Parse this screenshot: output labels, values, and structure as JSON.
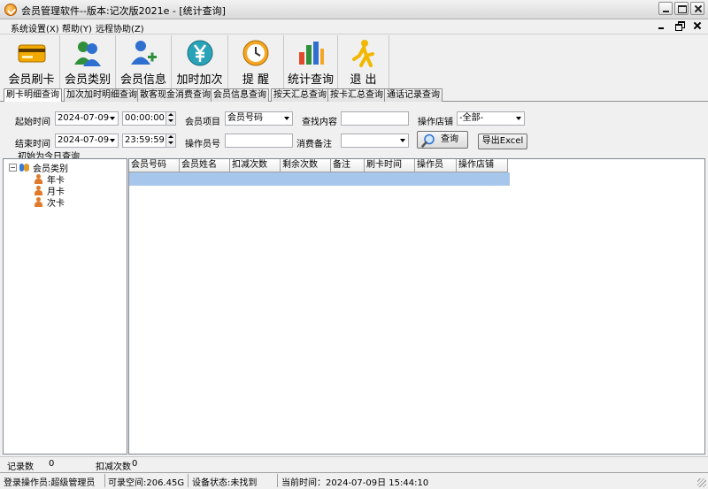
{
  "window": {
    "title": "会员管理软件--版本:记次版2021e - [统计查询]"
  },
  "menu": {
    "items": [
      "系统设置(X)",
      "帮助(Y)",
      "远程协助(Z)"
    ]
  },
  "toolbar": {
    "buttons": [
      {
        "label": "会员刷卡",
        "icon": "card-icon"
      },
      {
        "label": "会员类别",
        "icon": "users-icon"
      },
      {
        "label": "会员信息",
        "icon": "add-user-icon"
      },
      {
        "label": "加时加次",
        "icon": "yen-icon"
      },
      {
        "label": "提 醒",
        "icon": "clock-icon"
      },
      {
        "label": "统计查询",
        "icon": "bar-chart-icon"
      },
      {
        "label": "退 出",
        "icon": "exit-icon"
      }
    ]
  },
  "tabs": [
    {
      "label": "刷卡明细查询",
      "active": true
    },
    {
      "label": "加次加时明细查询",
      "active": false
    },
    {
      "label": "散客现金消费查询",
      "active": false
    },
    {
      "label": "会员信息查询",
      "active": false
    },
    {
      "label": "按天汇总查询",
      "active": false
    },
    {
      "label": "按卡汇总查询",
      "active": false
    },
    {
      "label": "通话记录查询",
      "active": false
    }
  ],
  "filters": {
    "start_label": "起始时间",
    "start_date": "2024-07-09",
    "start_time": "00:00:00",
    "end_label": "结束时间",
    "end_date": "2024-07-09",
    "end_time": "23:59:59",
    "member_item_label": "会员项目",
    "member_item_value": "会员号码",
    "search_content_label": "查找内容",
    "search_content_value": "",
    "store_label": "操作店铺",
    "store_value": "-全部-",
    "operator_label": "操作员号",
    "operator_value": "",
    "remark_label": "消费备注",
    "remark_value": "",
    "query_button": "查询",
    "export_button": "导出Excel",
    "hint": "初始为今日查询"
  },
  "tree": {
    "root": "会员类别",
    "children": [
      "年卡",
      "月卡",
      "次卡"
    ]
  },
  "grid": {
    "columns": [
      "会员号码",
      "会员姓名",
      "扣减次数",
      "剩余次数",
      "备注",
      "刷卡时间",
      "操作员",
      "操作店铺"
    ]
  },
  "summary": {
    "record_count_label": "记录数",
    "record_count_value": "0",
    "deduct_label": "扣减次数",
    "deduct_value": "0"
  },
  "statusbar": {
    "operator": "登录操作员:超级管理员",
    "free_space": "可录空间:206.45G",
    "device": "设备状态:未找到",
    "time": "当前时间：2024-07-09日 15:44:10"
  },
  "colors": {
    "selected_row": "#a7c6ec",
    "accent_orange": "#f5a623",
    "chart_blue": "#2f6fd0"
  }
}
